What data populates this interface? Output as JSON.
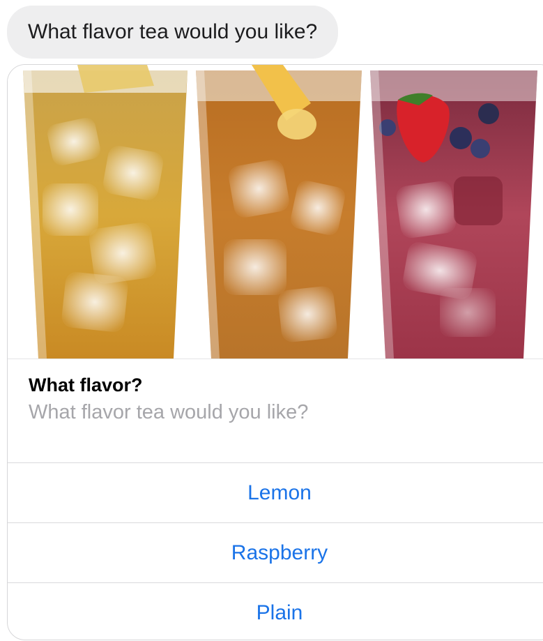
{
  "message": {
    "text": "What flavor tea would you like?"
  },
  "card": {
    "image": {
      "subject": "three glasses of iced tea with lemon and raspberry garnish"
    },
    "title": "What flavor?",
    "subtitle": "What flavor tea would you like?",
    "options": [
      {
        "label": "Lemon"
      },
      {
        "label": "Raspberry"
      },
      {
        "label": "Plain"
      }
    ]
  },
  "colors": {
    "bubble_bg": "#eeeeef",
    "link": "#1a73e8",
    "subtitle": "#a6a6aa",
    "divider": "#d9d9dc"
  }
}
